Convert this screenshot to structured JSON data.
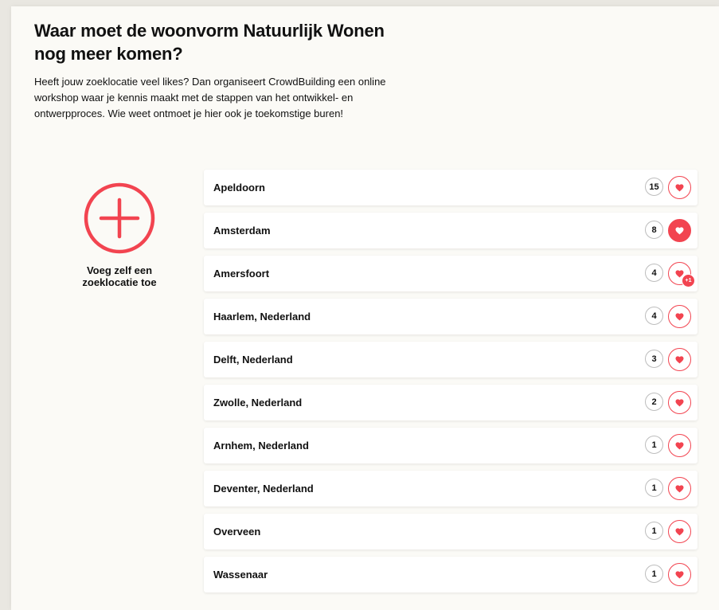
{
  "page": {
    "title": "Waar moet de woonvorm Natuurlijk Wonen nog meer komen?",
    "intro": "Heeft jouw zoeklocatie veel likes? Dan organiseert CrowdBuilding een online workshop waar je kennis maakt met de stappen van het ontwikkel- en ontwerpproces. Wie weet ontmoet je hier ook je toekomstige buren!"
  },
  "add_location": {
    "label": "Voeg zelf een zoeklocatie toe",
    "icon": "plus-circle-icon"
  },
  "colors": {
    "accent": "#f24450",
    "background": "#fbfaf6",
    "count_border": "#bdbdbd"
  },
  "locations": [
    {
      "name": "Apeldoorn",
      "likes": "15",
      "liked": false,
      "badge": ""
    },
    {
      "name": "Amsterdam",
      "likes": "8",
      "liked": true,
      "badge": ""
    },
    {
      "name": "Amersfoort",
      "likes": "4",
      "liked": false,
      "badge": "+1"
    },
    {
      "name": "Haarlem, Nederland",
      "likes": "4",
      "liked": false,
      "badge": ""
    },
    {
      "name": "Delft, Nederland",
      "likes": "3",
      "liked": false,
      "badge": ""
    },
    {
      "name": "Zwolle, Nederland",
      "likes": "2",
      "liked": false,
      "badge": ""
    },
    {
      "name": "Arnhem, Nederland",
      "likes": "1",
      "liked": false,
      "badge": ""
    },
    {
      "name": "Deventer, Nederland",
      "likes": "1",
      "liked": false,
      "badge": ""
    },
    {
      "name": "Overveen",
      "likes": "1",
      "liked": false,
      "badge": ""
    },
    {
      "name": "Wassenaar",
      "likes": "1",
      "liked": false,
      "badge": ""
    }
  ]
}
